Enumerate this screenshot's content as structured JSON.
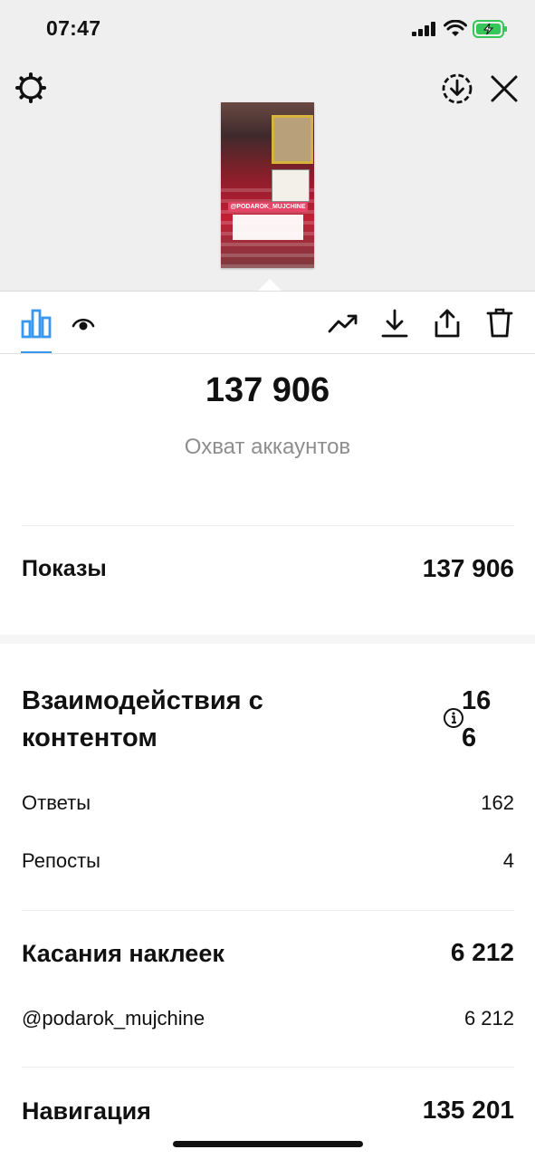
{
  "status_bar": {
    "time": "07:47"
  },
  "preview": {
    "sticker_handle": "@PODAROK_MUJCHINE"
  },
  "summary": {
    "accounts_reached_value": "137 906",
    "accounts_reached_label": "Охват аккаунтов"
  },
  "impressions": {
    "label": "Показы",
    "value": "137 906"
  },
  "interactions": {
    "title": "Взаимодействия с контентом",
    "value": "16\n6",
    "rows": [
      {
        "label": "Ответы",
        "value": "162"
      },
      {
        "label": "Репосты",
        "value": "4"
      }
    ]
  },
  "sticker_taps": {
    "label": "Касания наклеек",
    "value": "6 212",
    "rows": [
      {
        "label": "@podarok_mujchine",
        "value": "6 212"
      }
    ]
  },
  "navigation": {
    "label": "Навигация",
    "value": "135 201"
  },
  "colors": {
    "accent": "#3897f0",
    "header_bg": "#efefef",
    "muted_text": "#8e8e8e",
    "battery_green": "#35c759"
  }
}
